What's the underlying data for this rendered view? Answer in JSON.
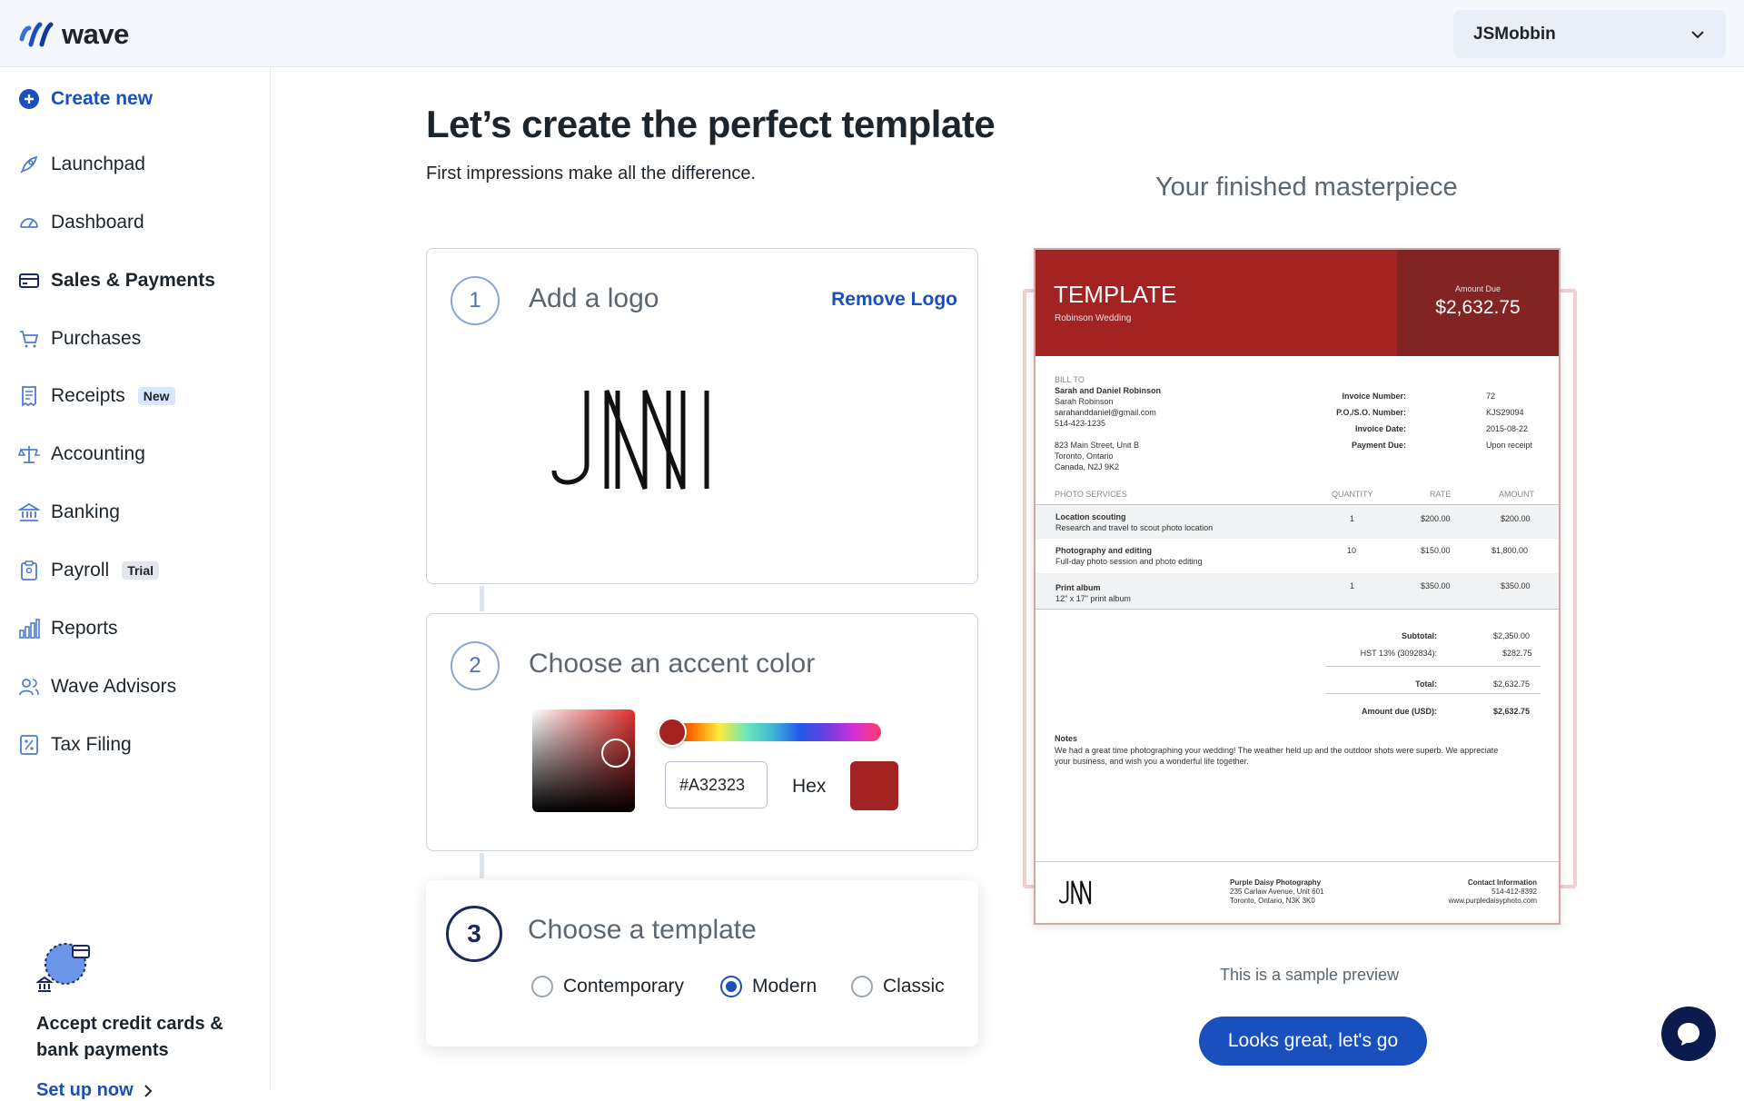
{
  "topbar": {
    "brand": "wave",
    "account_name": "JSMobbin"
  },
  "sidebar": {
    "create_new": "Create new",
    "items": [
      {
        "label": "Launchpad",
        "icon": "rocket-icon"
      },
      {
        "label": "Dashboard",
        "icon": "gauge-icon"
      },
      {
        "label": "Sales & Payments",
        "icon": "card-icon"
      },
      {
        "label": "Purchases",
        "icon": "cart-icon"
      },
      {
        "label": "Receipts",
        "icon": "receipt-icon",
        "badge": "New"
      },
      {
        "label": "Accounting",
        "icon": "scale-icon"
      },
      {
        "label": "Banking",
        "icon": "bank-icon"
      },
      {
        "label": "Payroll",
        "icon": "clipboard-icon",
        "badge": "Trial"
      },
      {
        "label": "Reports",
        "icon": "bar-chart-icon"
      },
      {
        "label": "Wave Advisors",
        "icon": "people-icon"
      },
      {
        "label": "Tax Filing",
        "icon": "percent-doc-icon"
      }
    ],
    "promo": {
      "title": "Accept credit cards & bank payments",
      "link": "Set up now"
    }
  },
  "main": {
    "title": "Let’s create the perfect template",
    "subtitle": "First impressions make all the difference.",
    "steps": [
      {
        "num": "1",
        "title": "Add a logo",
        "action": "Remove Logo"
      },
      {
        "num": "2",
        "title": "Choose an accent color",
        "hex_value": "#A32323",
        "hex_label": "Hex"
      },
      {
        "num": "3",
        "title": "Choose a template",
        "options": [
          "Contemporary",
          "Modern",
          "Classic"
        ],
        "selected": "Modern"
      }
    ],
    "preview_heading": "Your finished masterpiece",
    "sample_note": "This is a sample preview",
    "cta": "Looks great, let's go"
  },
  "colors": {
    "accent": "#a32323",
    "brand_blue": "#1a4fbe",
    "accent_dark": "#822424"
  },
  "invoice": {
    "title": "TEMPLATE",
    "subtitle": "Robinson Wedding",
    "amount_due_label": "Amount Due",
    "amount_due": "$2,632.75",
    "bill_to_label": "BILL TO",
    "bill_to": [
      "Sarah and Daniel Robinson",
      "Sarah Robinson",
      "sarahanddaniel@gmail.com",
      "514-423-1235"
    ],
    "address": [
      "823 Main Street, Unit B",
      "Toronto, Ontario",
      "Canada, N2J 9K2"
    ],
    "meta": [
      {
        "k": "Invoice Number:",
        "v": "72"
      },
      {
        "k": "P.O./S.O. Number:",
        "v": "KJS29094"
      },
      {
        "k": "Invoice Date:",
        "v": "2015-08-22"
      },
      {
        "k": "Payment Due:",
        "v": "Upon receipt"
      }
    ],
    "columns": [
      "PHOTO SERVICES",
      "QUANTITY",
      "RATE",
      "AMOUNT"
    ],
    "rows": [
      {
        "name": "Location scouting",
        "desc": "Research and travel to scout photo location",
        "qty": "1",
        "rate": "$200.00",
        "amount": "$200.00"
      },
      {
        "name": "Photography and editing",
        "desc": "Full-day photo session and photo editing",
        "qty": "10",
        "rate": "$150.00",
        "amount": "$1,800.00"
      },
      {
        "name": "Print album",
        "desc": "12\" x 17\" print album",
        "qty": "1",
        "rate": "$350.00",
        "amount": "$350.00"
      }
    ],
    "totals": [
      {
        "k": "Subtotal:",
        "v": "$2,350.00"
      },
      {
        "k": "HST 13% (3092834):",
        "v": "$282.75"
      },
      {
        "k": "Total:",
        "v": "$2,632.75"
      },
      {
        "k": "Amount due (USD):",
        "v": "$2,632.75"
      }
    ],
    "notes_label": "Notes",
    "notes": "We had a great time photographing your wedding! The weather held up and the outdoor shots were superb. We appreciate your business, and wish you a wonderful life together.",
    "footer_company": [
      "Purple Daisy Photography",
      "235 Carlaw Avenue, Unit 601",
      "Toronto, Ontario, N3K 3K0"
    ],
    "footer_contact": [
      "Contact Information",
      "514-412-8392",
      "www.purpledaisyphoto.com"
    ]
  }
}
